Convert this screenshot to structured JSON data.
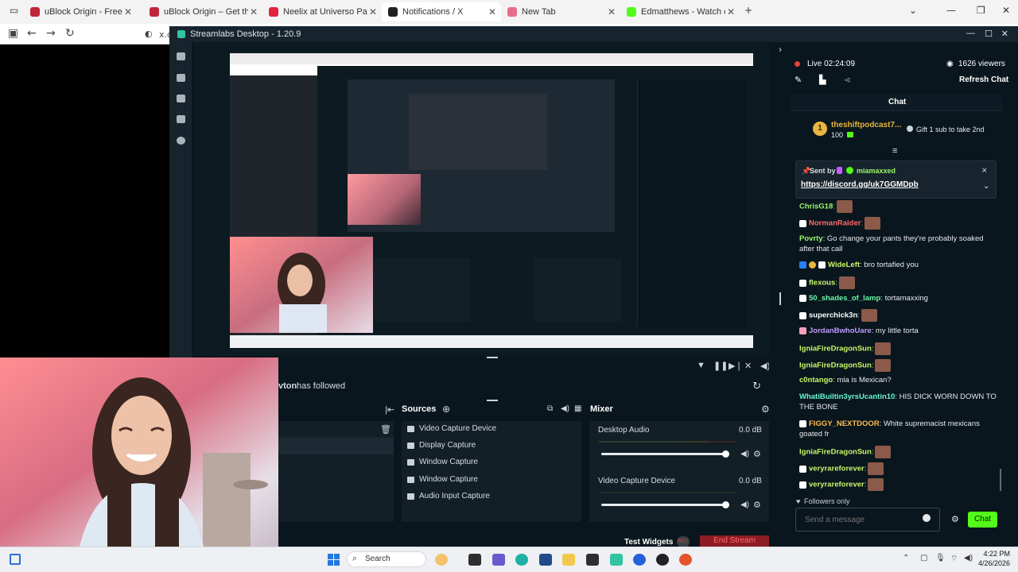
{
  "browser": {
    "tabs": [
      {
        "title": "uBlock Origin - Free, open-sou",
        "color": "#c0263a"
      },
      {
        "title": "uBlock Origin – Get this Extensi",
        "color": "#c0263a"
      },
      {
        "title": "Neelix at Universo Paralello - Yo",
        "color": "#e0223b"
      },
      {
        "title": "Notifications / X",
        "color": "#222222"
      },
      {
        "title": "New Tab",
        "color": "#e66c8a"
      },
      {
        "title": "Edmatthews - Watch clips on Ki",
        "color": "#53fc18"
      }
    ],
    "address_prefix": "x.c"
  },
  "streamlabs": {
    "title": "Streamlabs Desktop - 1.20.9",
    "live_status": "Live 02:24:09",
    "viewers": "1626 viewers",
    "refresh_chat": "Refresh Chat",
    "follow_user": "vton",
    "follow_text": "has followed",
    "sources_title": "Sources",
    "mixer_title": "Mixer",
    "sources": [
      "Video Capture Device",
      "Display Capture",
      "Window Capture",
      "Window Capture",
      "Audio Input Capture"
    ],
    "mixer": [
      {
        "name": "Desktop Audio",
        "db": "0.0 dB",
        "level": 1.0
      },
      {
        "name": "Video Capture Device",
        "db": "0.0 dB",
        "level": 1.0
      }
    ],
    "test_widgets": "Test Widgets",
    "rec_label": "REC",
    "end_stream": "End Stream"
  },
  "chat": {
    "title": "Chat",
    "gift_user": "theshiftpodcast7...",
    "gift_amount": "100",
    "gift_text": "Gift 1 sub to take 2nd",
    "pinned_sent_by": "Sent by",
    "pinned_user": "miamaxxed",
    "pinned_link": "https://discord.gg/uk7GGMDpb",
    "messages": [
      {
        "user": "ChrisG18",
        "color": "#9cf76b",
        "text": ""
      },
      {
        "user": "NormanRaider",
        "color": "#ff6a6a",
        "text": ""
      },
      {
        "user": "Povrty",
        "color": "#9cf76b",
        "text": ": Go change your pants they're probably soaked after that call"
      },
      {
        "user": "WideLeft",
        "color": "#c8f76b",
        "text": ": bro tortafied you"
      },
      {
        "user": "flexous",
        "color": "#c8f76b",
        "text": ""
      },
      {
        "user": "50_shades_of_lamp",
        "color": "#6bf7a7",
        "text": ": tortamaxxing"
      },
      {
        "user": "superchick3n",
        "color": "#ffffff",
        "text": ""
      },
      {
        "user": "JordanBwhoUare",
        "color": "#c09bff",
        "text": ": my little torta"
      },
      {
        "user": "IgniaFireDragonSun",
        "color": "#c8f76b",
        "text": ""
      },
      {
        "user": "IgniaFireDragonSun",
        "color": "#c8f76b",
        "text": ""
      },
      {
        "user": "c0ntango",
        "color": "#c8f76b",
        "text": ": mia is Mexican?"
      },
      {
        "user": "WhatiBuiltin3yrsUcantin10",
        "color": "#6bf7d0",
        "text": ": HIS DICK WORN DOWN TO THE BONE"
      },
      {
        "user": "FIGGY_NEXTDOOR",
        "color": "#ffbb55",
        "text": ": White supremacist mexicans goated fr"
      },
      {
        "user": "IgniaFireDragonSun",
        "color": "#c8f76b",
        "text": ""
      },
      {
        "user": "veryrareforever",
        "color": "#c8f76b",
        "text": ""
      },
      {
        "user": "veryrareforever",
        "color": "#c8f76b",
        "text": ""
      }
    ],
    "followers_only": "Followers only",
    "input_placeholder": "Send a message",
    "chat_button": "Chat"
  },
  "taskbar": {
    "search_label": "Search",
    "time": "4:22 PM",
    "date": "4/26/2026"
  },
  "colors": {
    "accent": "#31c3a2",
    "chat_btn": "#53fc18",
    "end_stream": "#8d1d25"
  }
}
